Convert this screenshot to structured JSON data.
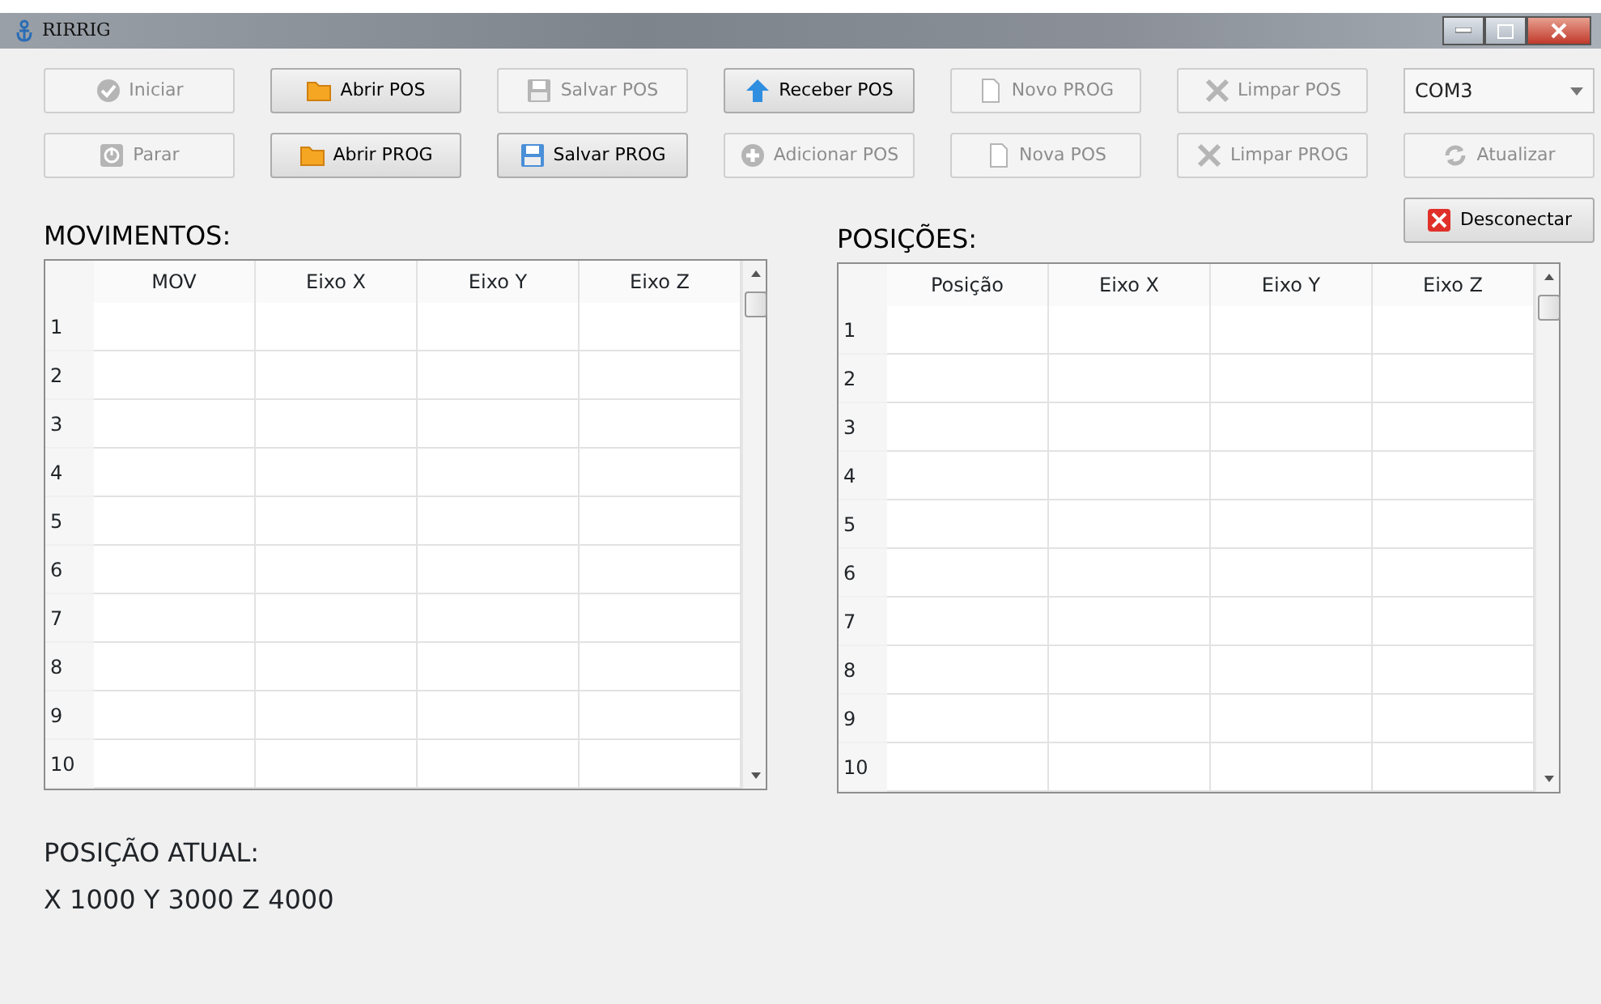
{
  "window": {
    "title": "RIRRIG"
  },
  "toolbar": [
    {
      "label": "Iniciar",
      "kind": "check",
      "disabled": true
    },
    {
      "label": "Abrir POS",
      "kind": "folder",
      "disabled": false
    },
    {
      "label": "Salvar POS",
      "kind": "disk",
      "disabled": true
    },
    {
      "label": "Receber POS",
      "kind": "arrow",
      "disabled": false
    },
    {
      "label": "Novo PROG",
      "kind": "page",
      "disabled": true
    },
    {
      "label": "Limpar POS",
      "kind": "cross",
      "disabled": true
    },
    {
      "label": "Parar",
      "kind": "power",
      "disabled": true
    },
    {
      "label": "Abrir PROG",
      "kind": "folder",
      "disabled": false
    },
    {
      "label": "Salvar PROG",
      "kind": "disk",
      "disabled": false
    },
    {
      "label": "Adicionar POS",
      "kind": "plus",
      "disabled": true
    },
    {
      "label": "Nova POS",
      "kind": "page",
      "disabled": true
    },
    {
      "label": "Limpar PROG",
      "kind": "cross",
      "disabled": true
    }
  ],
  "port": {
    "value": "COM3"
  },
  "refresh_button": {
    "label": "Atualizar",
    "kind": "refresh",
    "disabled": true
  },
  "disconnect_button": {
    "label": "Desconectar",
    "kind": "redx",
    "disabled": false
  },
  "tables": [
    {
      "title": "MOVIMENTOS:",
      "columns": [
        "MOV",
        "Eixo X",
        "Eixo Y",
        "Eixo Z"
      ],
      "rows": [
        "1",
        "2",
        "3",
        "4",
        "5",
        "6",
        "7",
        "8",
        "9",
        "10"
      ]
    },
    {
      "title": "POSIÇÕES:",
      "columns": [
        "Posição",
        "Eixo X",
        "Eixo Y",
        "Eixo Z"
      ],
      "rows": [
        "1",
        "2",
        "3",
        "4",
        "5",
        "6",
        "7",
        "8",
        "9",
        "10"
      ]
    }
  ],
  "current_position": {
    "title": "POSIÇÃO ATUAL:",
    "value": "X 1000 Y 3000 Z 4000"
  }
}
